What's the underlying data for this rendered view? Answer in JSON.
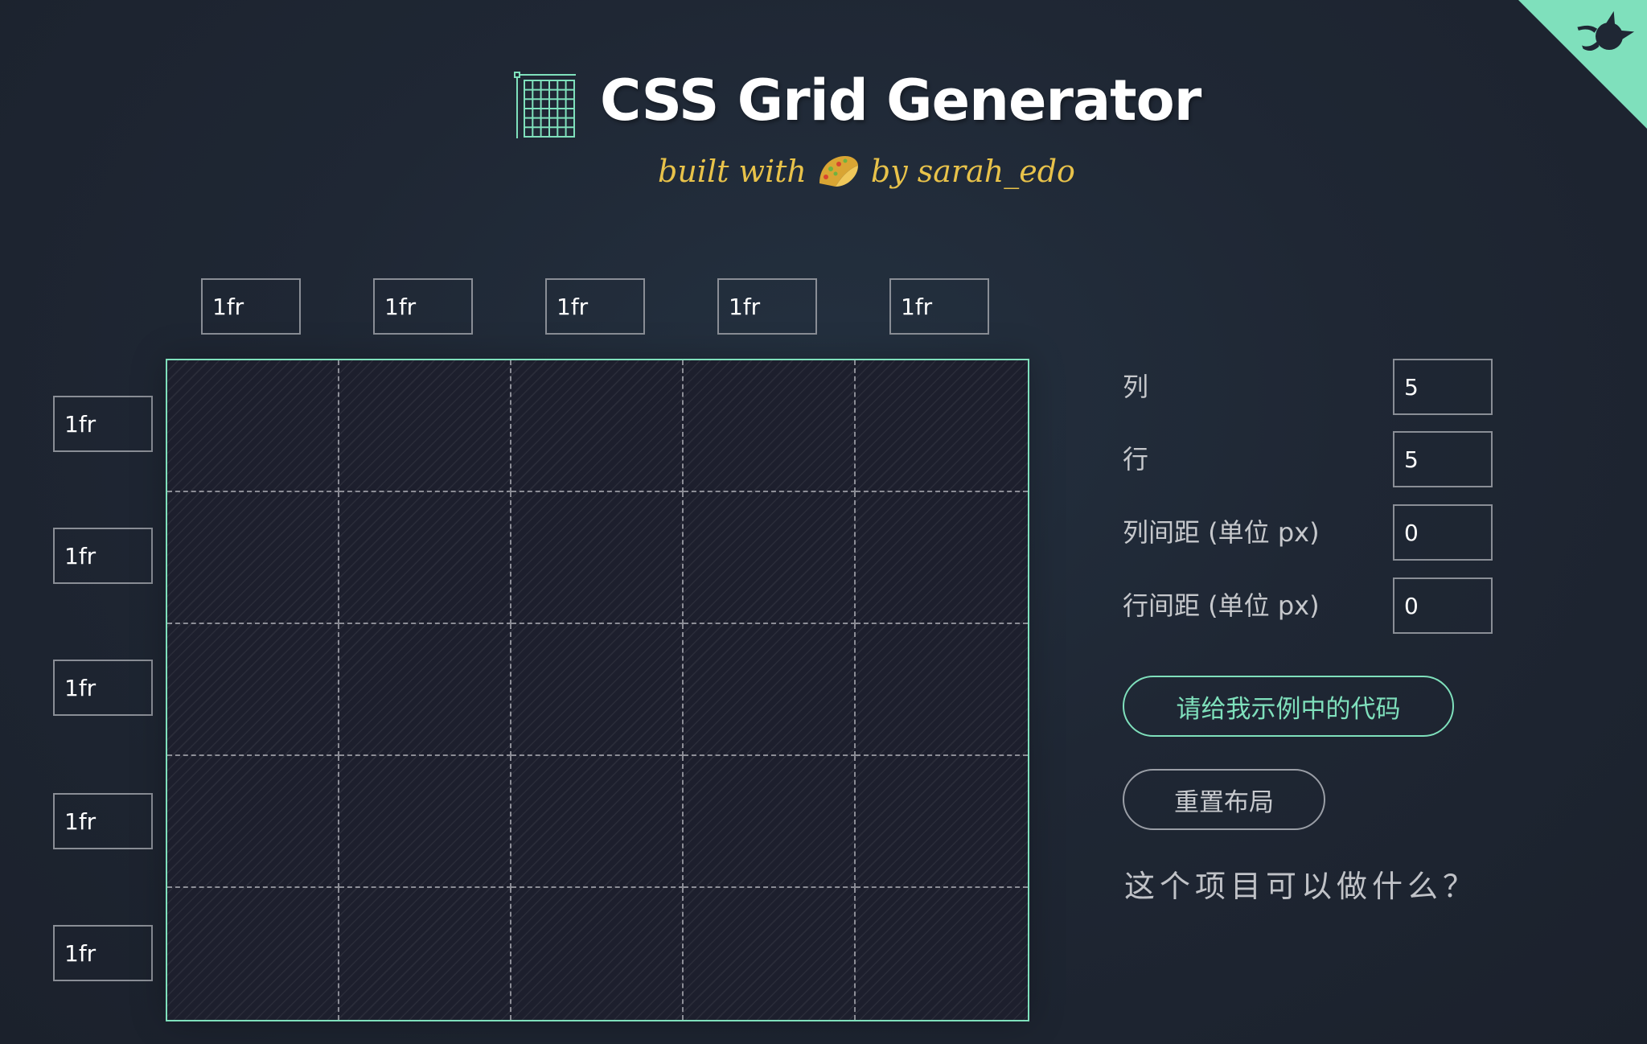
{
  "header": {
    "title": "CSS Grid Generator",
    "subtitle_prefix": "built with",
    "subtitle_suffix": "by sarah_edo",
    "logo_icon": "grid-logo-icon",
    "taco_icon": "taco-icon"
  },
  "github_corner": {
    "icon": "github-octocat-icon",
    "color": "#7fe0bc"
  },
  "columns": [
    {
      "value": "1fr"
    },
    {
      "value": "1fr"
    },
    {
      "value": "1fr"
    },
    {
      "value": "1fr"
    },
    {
      "value": "1fr"
    }
  ],
  "rows": [
    {
      "value": "1fr"
    },
    {
      "value": "1fr"
    },
    {
      "value": "1fr"
    },
    {
      "value": "1fr"
    },
    {
      "value": "1fr"
    }
  ],
  "controls": {
    "columns_label": "列",
    "columns_value": "5",
    "rows_label": "行",
    "rows_value": "5",
    "column_gap_label": "列间距 (单位 px)",
    "column_gap_value": "0",
    "row_gap_label": "行间距 (单位 px)",
    "row_gap_value": "0"
  },
  "buttons": {
    "get_code": "请给我示例中的代码",
    "reset": "重置布局"
  },
  "about_link": "这个项目可以做什么？",
  "colors": {
    "accent": "#7fe0bc",
    "title": "#ffffff",
    "subtitle": "#e8c24a",
    "background": "#1f2734"
  }
}
